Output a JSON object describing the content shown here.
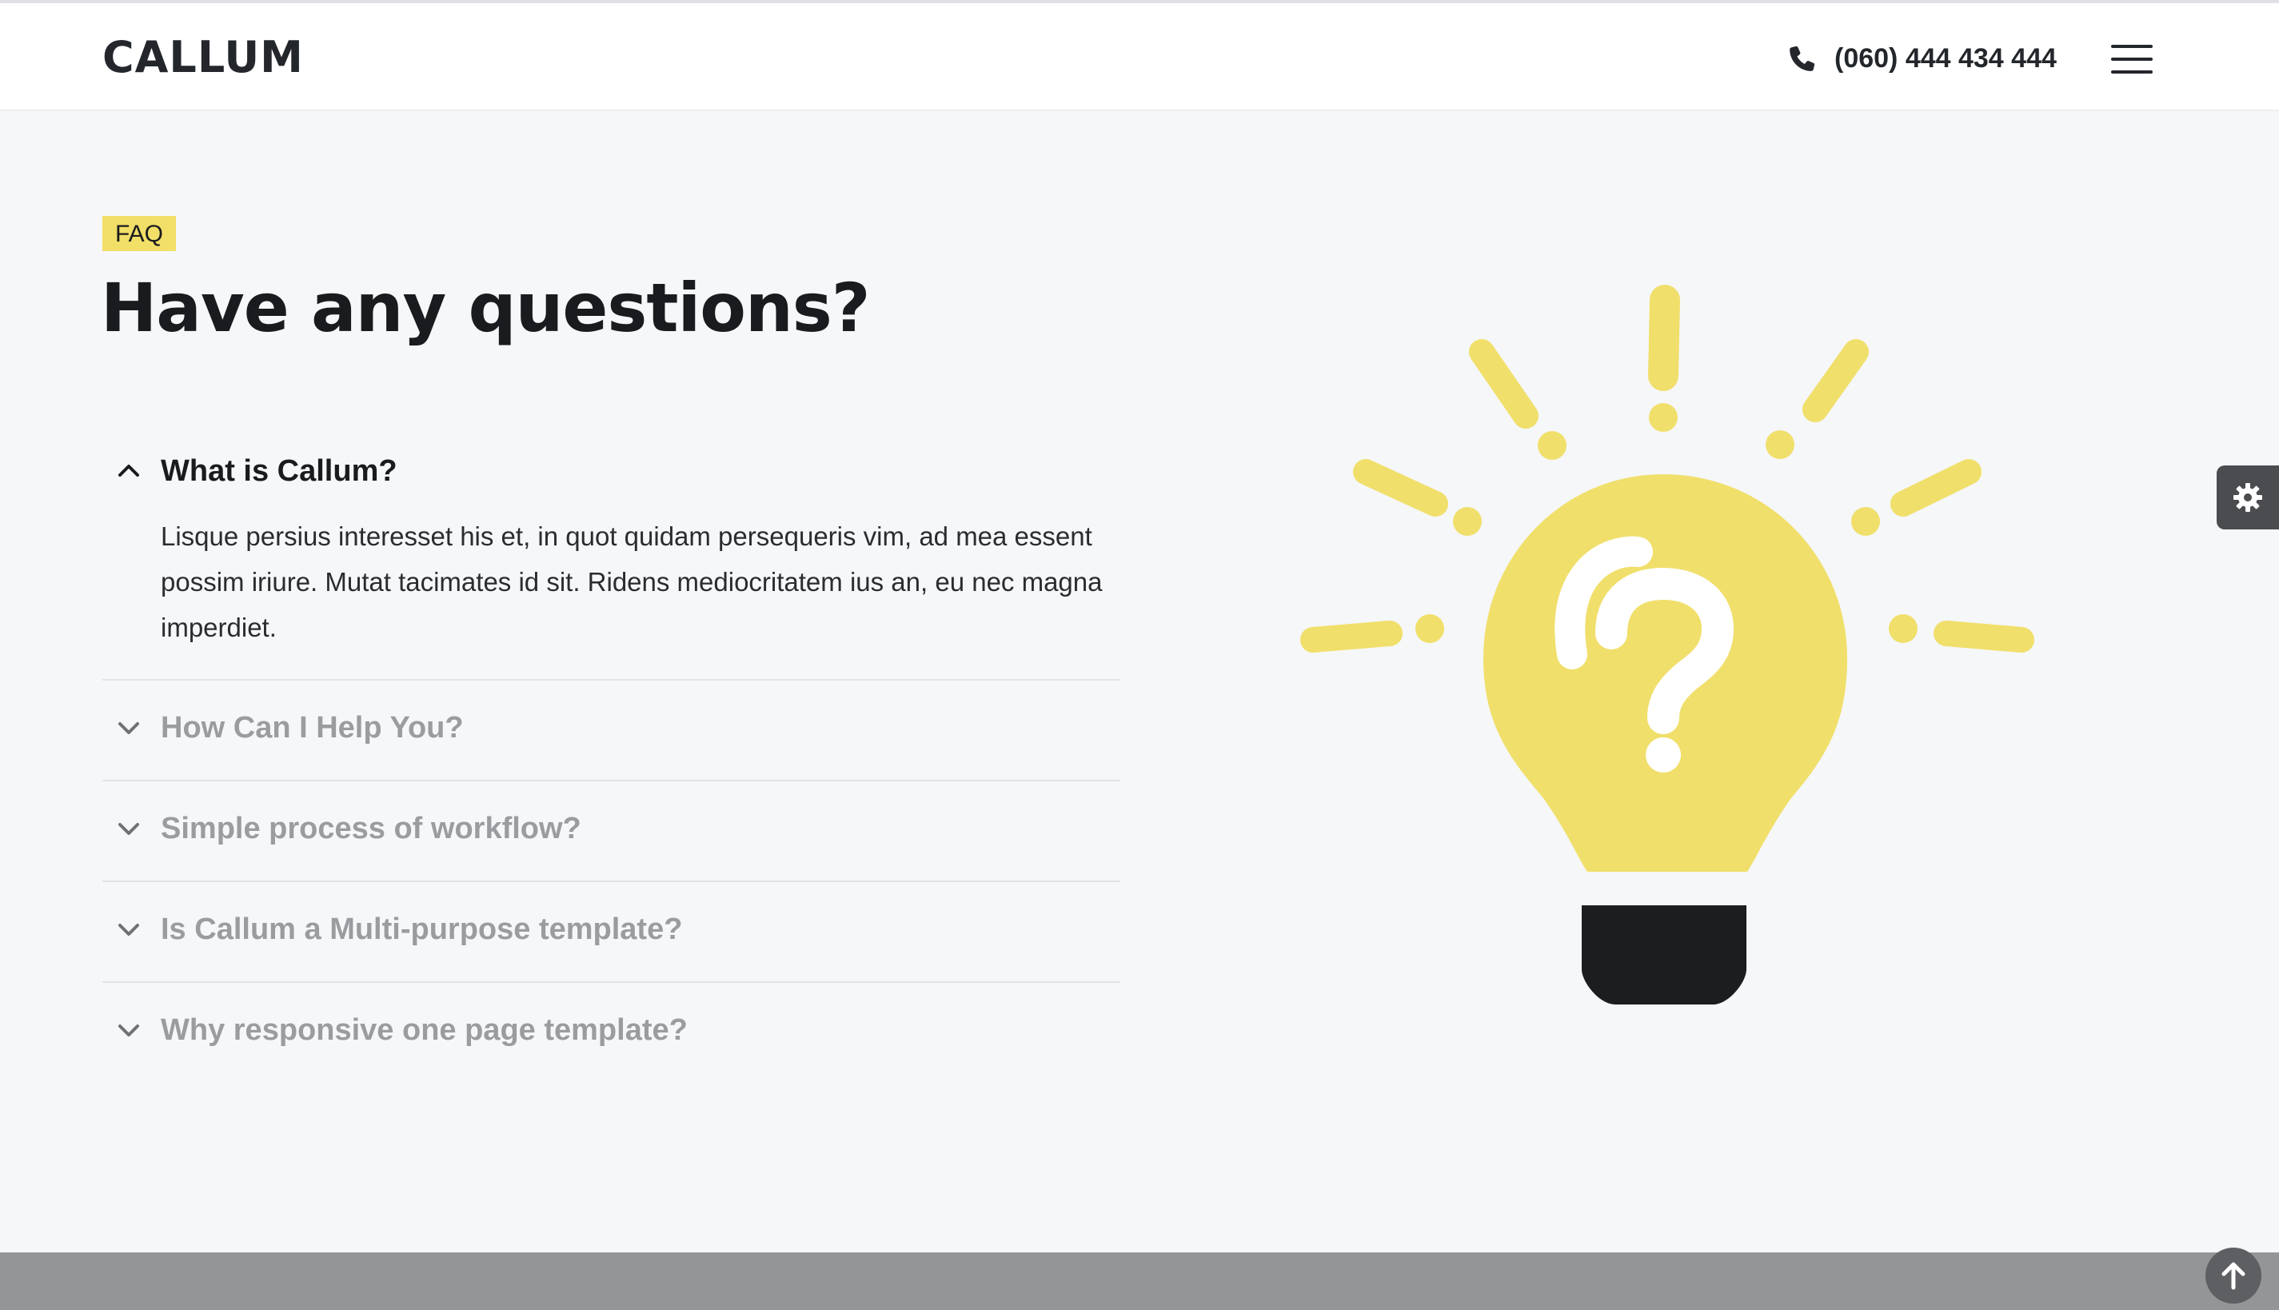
{
  "header": {
    "logo": "CALLUM",
    "phone": "(060) 444 434 444",
    "icons": {
      "phone": "phone-icon",
      "menu": "hamburger-menu-icon"
    }
  },
  "faq_section": {
    "badge": "FAQ",
    "title": "Have any questions?",
    "items": [
      {
        "question": "What is Callum?",
        "answer": "Lisque persius interesset his et, in quot quidam persequeris vim, ad mea essent possim iriure. Mutat tacimates id sit. Ridens mediocritatem ius an, eu nec magna imperdiet.",
        "expanded": true
      },
      {
        "question": "How Can I Help You?",
        "expanded": false
      },
      {
        "question": "Simple process of workflow?",
        "expanded": false
      },
      {
        "question": "Is Callum a Multi-purpose template?",
        "expanded": false
      },
      {
        "question": "Why responsive one page template?",
        "expanded": false
      }
    ],
    "illustration": "lightbulb-question-icon"
  },
  "floating": {
    "settings_icon": "gear-icon",
    "scroll_top_icon": "arrow-up-icon"
  },
  "colors": {
    "accent_yellow": "#f1df68",
    "text_dark": "#1a1b1e",
    "text_muted": "#9a9ca0",
    "background": "#f6f7f8",
    "footer_band": "#939597"
  }
}
